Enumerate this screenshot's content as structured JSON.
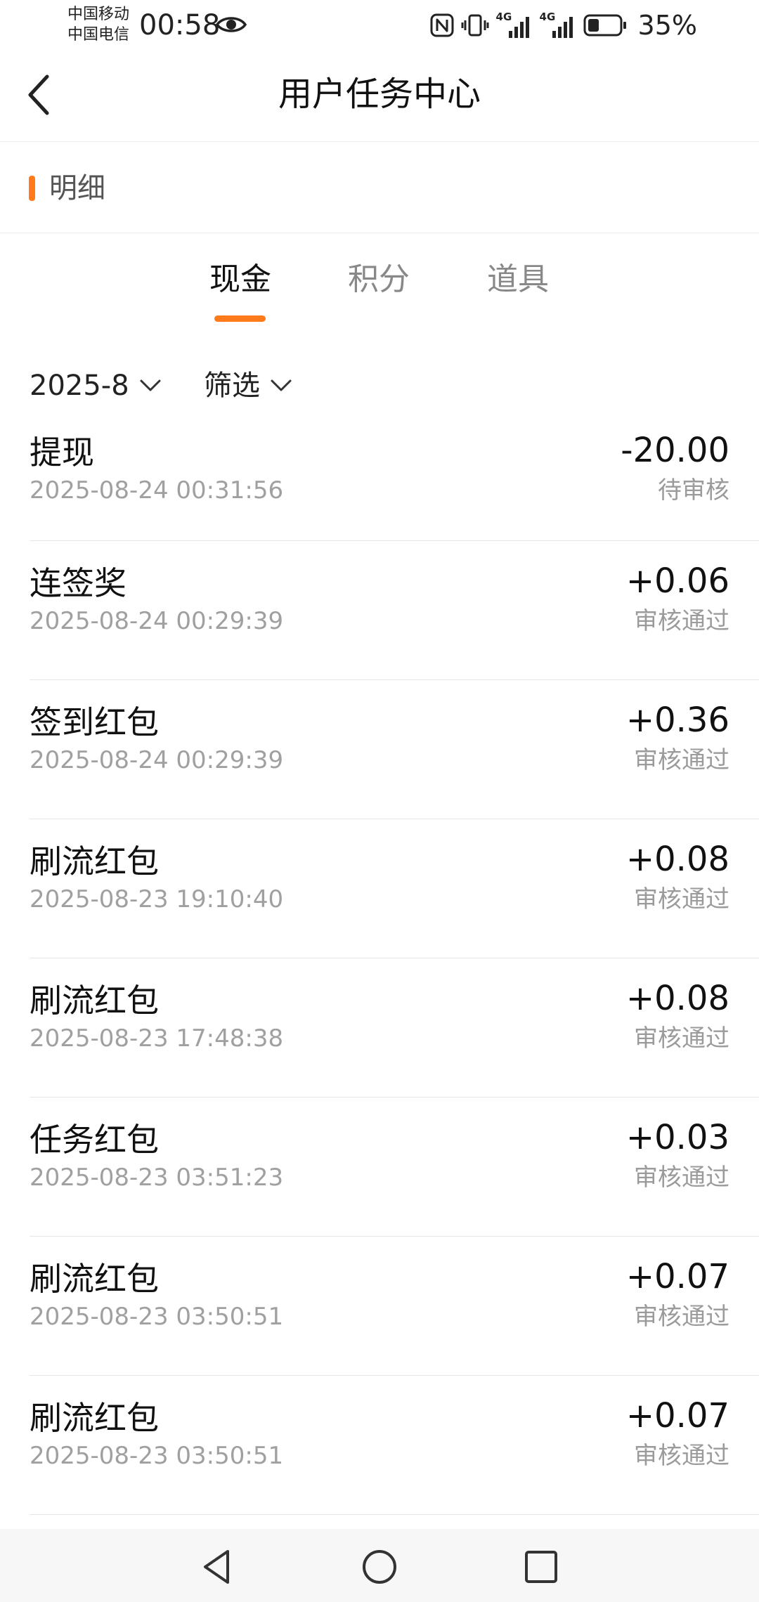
{
  "status_bar": {
    "carrier_1": "中国移动",
    "carrier_2": "中国电信",
    "time": "00:58",
    "network_1": "4G",
    "network_2": "4G",
    "battery_percent": "35%",
    "battery_level": 0.35,
    "icons": [
      "eye-icon",
      "nfc-icon",
      "vibrate-icon",
      "signal-icon",
      "signal-icon",
      "battery-icon"
    ]
  },
  "header": {
    "title": "用户任务中心",
    "back_icon": "chevron-left-icon"
  },
  "section": {
    "title": "明细",
    "accent_color": "#ff7a1a"
  },
  "tabs": [
    {
      "label": "现金",
      "active": true
    },
    {
      "label": "积分",
      "active": false
    },
    {
      "label": "道具",
      "active": false
    }
  ],
  "filters": {
    "date": "2025-8",
    "screen": "筛选"
  },
  "records": [
    {
      "title": "提现",
      "time": "2025-08-24 00:31:56",
      "amount": "-20.00",
      "status": "待审核"
    },
    {
      "title": "连签奖",
      "time": "2025-08-24 00:29:39",
      "amount": "+0.06",
      "status": "审核通过"
    },
    {
      "title": "签到红包",
      "time": "2025-08-24 00:29:39",
      "amount": "+0.36",
      "status": "审核通过"
    },
    {
      "title": "刷流红包",
      "time": "2025-08-23 19:10:40",
      "amount": "+0.08",
      "status": "审核通过"
    },
    {
      "title": "刷流红包",
      "time": "2025-08-23 17:48:38",
      "amount": "+0.08",
      "status": "审核通过"
    },
    {
      "title": "任务红包",
      "time": "2025-08-23 03:51:23",
      "amount": "+0.03",
      "status": "审核通过"
    },
    {
      "title": "刷流红包",
      "time": "2025-08-23 03:50:51",
      "amount": "+0.07",
      "status": "审核通过"
    },
    {
      "title": "刷流红包",
      "time": "2025-08-23 03:50:51",
      "amount": "+0.07",
      "status": "审核通过"
    }
  ],
  "nav_bar": {
    "icons": [
      "nav-back-icon",
      "nav-home-icon",
      "nav-recent-icon"
    ]
  }
}
